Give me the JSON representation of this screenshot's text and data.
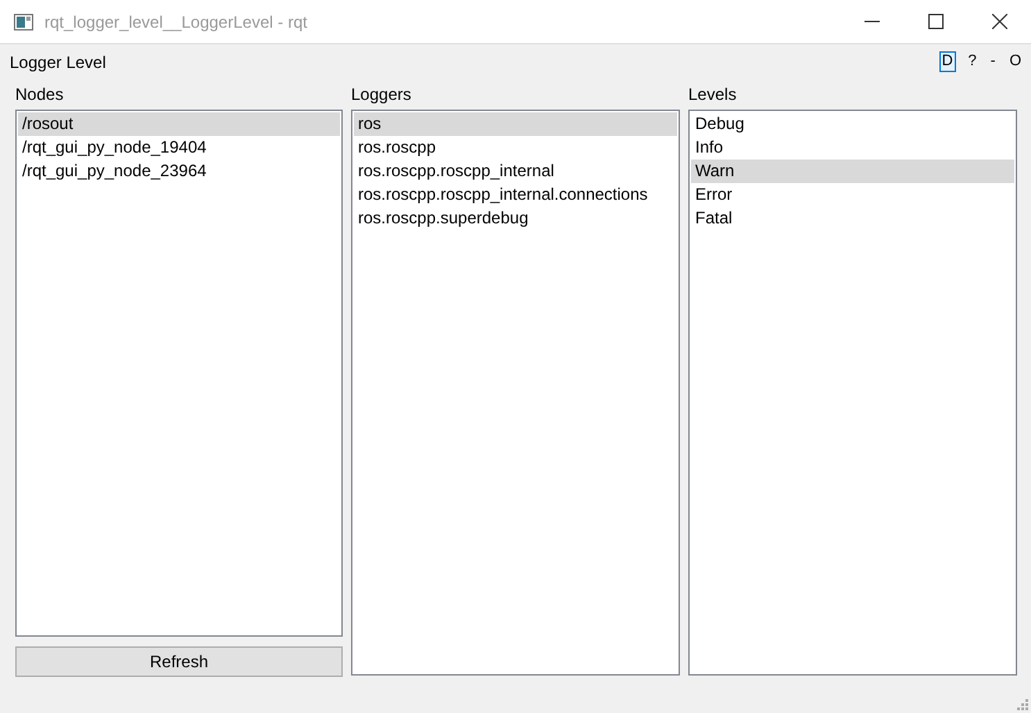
{
  "window": {
    "title": "rqt_logger_level__LoggerLevel - rqt"
  },
  "dock": {
    "title": "Logger Level",
    "buttons": [
      "D",
      "?",
      "-",
      "O"
    ]
  },
  "nodes": {
    "label": "Nodes",
    "items": [
      {
        "text": "/rosout",
        "selected": true
      },
      {
        "text": "/rqt_gui_py_node_19404",
        "selected": false
      },
      {
        "text": "/rqt_gui_py_node_23964",
        "selected": false
      }
    ]
  },
  "loggers": {
    "label": "Loggers",
    "items": [
      {
        "text": "ros",
        "selected": true
      },
      {
        "text": "ros.roscpp",
        "selected": false
      },
      {
        "text": "ros.roscpp.roscpp_internal",
        "selected": false
      },
      {
        "text": "ros.roscpp.roscpp_internal.connections",
        "selected": false
      },
      {
        "text": "ros.roscpp.superdebug",
        "selected": false
      }
    ]
  },
  "levels": {
    "label": "Levels",
    "items": [
      {
        "text": "Debug",
        "selected": false
      },
      {
        "text": "Info",
        "selected": false
      },
      {
        "text": "Warn",
        "selected": true
      },
      {
        "text": "Error",
        "selected": false
      },
      {
        "text": "Fatal",
        "selected": false
      }
    ]
  },
  "refresh_button": "Refresh"
}
